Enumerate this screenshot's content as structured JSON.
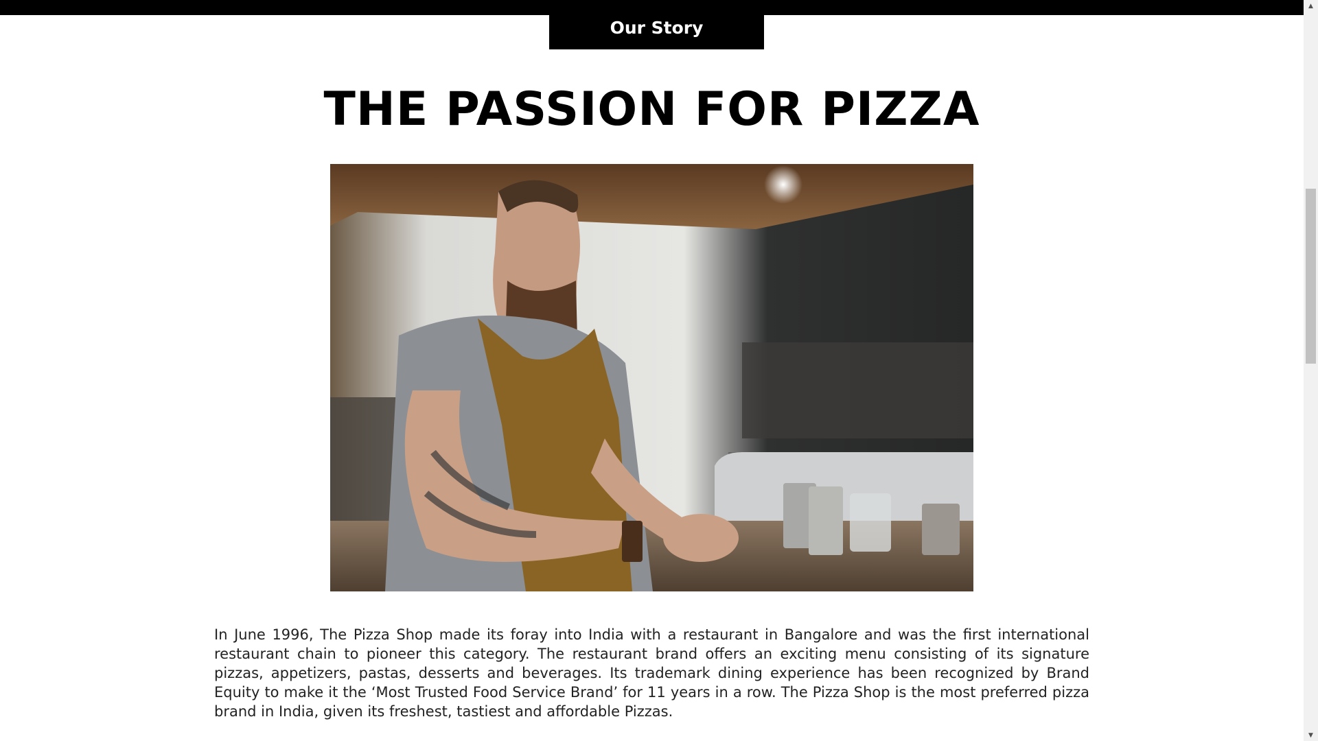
{
  "nav": {
    "tab_label": "Our Story"
  },
  "section": {
    "heading": "THE PASSION FOR PIZZA",
    "photo_icon": "chef-portrait-image",
    "paragraph": "In June 1996, The Pizza Shop made its foray into India with a restaurant in Bangalore and was the first international restaurant chain to pioneer this category. The restaurant brand offers an exciting menu consisting of its signature pizzas, appetizers, pastas, desserts and beverages. Its trademark dining experience has been recognized by Brand Equity to make it the ‘Most Trusted Food Service Brand’ for 11 years in a row. The Pizza Shop is the most preferred pizza brand in India, given its freshest, tastiest and affordable Pizzas."
  },
  "scrollbar": {
    "up_icon": "chevron-up-icon",
    "down_icon": "chevron-down-icon"
  },
  "colors": {
    "header_bg": "#000000",
    "header_text": "#ffffff",
    "body_text": "#222222"
  }
}
